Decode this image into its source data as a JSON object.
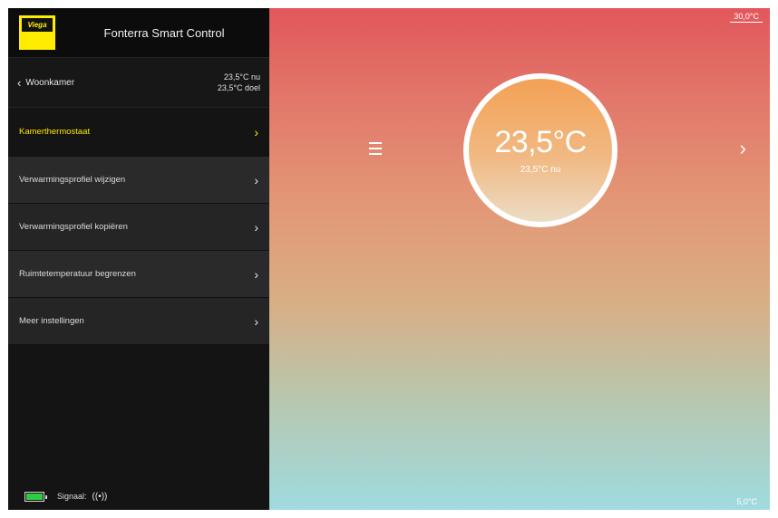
{
  "app": {
    "title": "Fonterra Smart Control",
    "logo_text": "Viega"
  },
  "room": {
    "back_label": "Woonkamer",
    "temp_now": "23,5°C nu",
    "temp_target": "23,5°C doel"
  },
  "menu": {
    "items": [
      {
        "label": "Kamerthermostaat",
        "arrow": "›"
      },
      {
        "label": "Verwarmingsprofiel wijzigen",
        "arrow": "›"
      },
      {
        "label": "Verwarmingsprofiel kopiëren",
        "arrow": "›"
      },
      {
        "label": "Ruimtetemperatuur begrenzen",
        "arrow": "›"
      },
      {
        "label": "Meer instellingen",
        "arrow": "›"
      }
    ]
  },
  "footer": {
    "signal_label": "Signaal:",
    "signal_icon": "((•))",
    "battery_level": 1.0
  },
  "main": {
    "max_temp": "30,0°C",
    "min_temp": "5,0°C",
    "dial_temp": "23,5°C",
    "dial_now": "23,5°C nu",
    "next_arrow": "›"
  },
  "colors": {
    "accent": "#ffe600",
    "battery": "#2ecc40",
    "sidebar_bg": "#141414"
  }
}
